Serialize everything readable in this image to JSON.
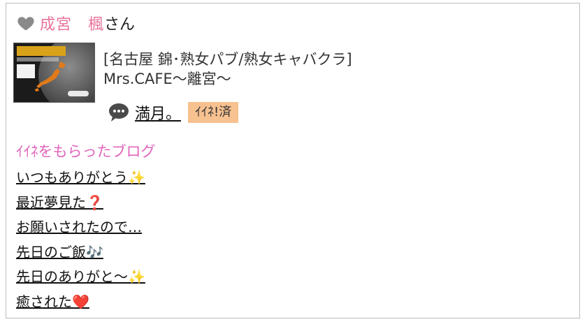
{
  "header": {
    "cast_name": "成宮　楓",
    "suffix": "さん"
  },
  "shop": {
    "category": "[名古屋 錦･熟女パブ/熟女キャバクラ]",
    "name": "Mrs.CAFE～離宮～"
  },
  "post": {
    "title": "満月。",
    "like_label": "ｲｲﾈ!済"
  },
  "section": {
    "title": "ｲｲﾈをもらったブログ"
  },
  "blogs": [
    {
      "text": "いつもありがとう",
      "emoji": "✨"
    },
    {
      "text": "最近夢見た",
      "emoji": "❓"
    },
    {
      "text": "お願いされたので…",
      "emoji": ""
    },
    {
      "text": "先日のご飯",
      "emoji": "🎶"
    },
    {
      "text": "先日のありがと～",
      "emoji": "✨"
    },
    {
      "text": "癒された",
      "emoji": "❤️"
    }
  ],
  "colors": {
    "accent_pink": "#e8739b",
    "section_pink": "#e065bd",
    "badge_orange": "#f7c190",
    "heart_gray": "#8a8a8a"
  },
  "icons": {
    "heart": "heart-icon",
    "chat": "speech-bubble-icon"
  }
}
